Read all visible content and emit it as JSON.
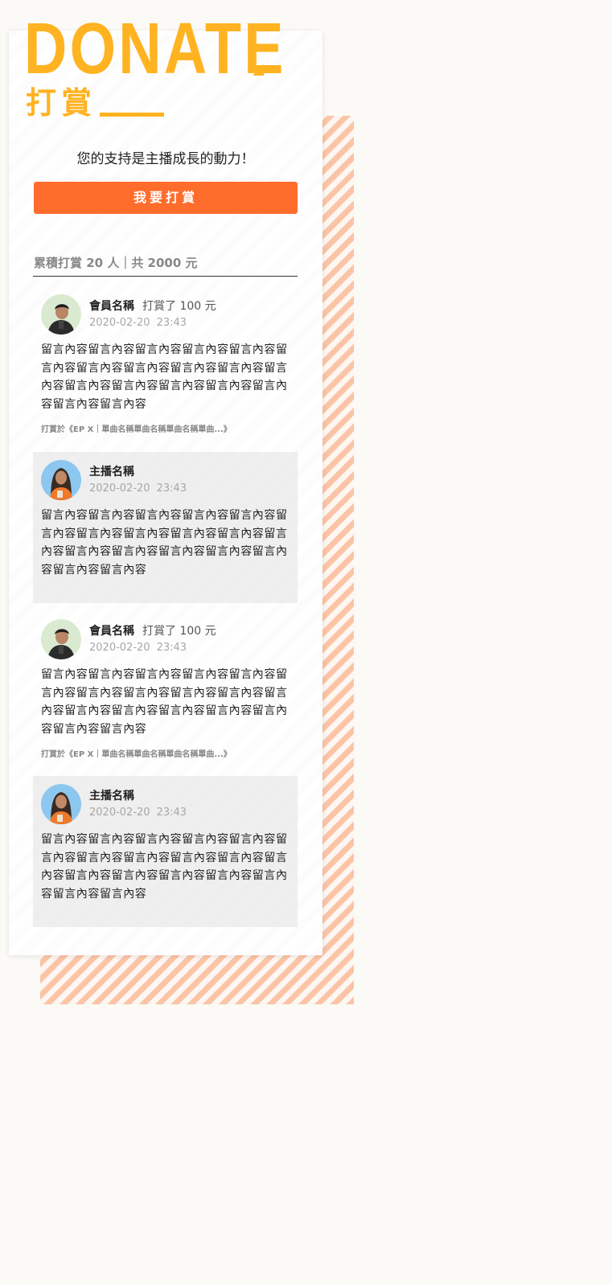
{
  "header": {
    "title_en": "DONATE",
    "title_zh": "打賞"
  },
  "support_text": "您的支持是主播成長的動力！",
  "donate_button_label": "我要打賞",
  "summary": "累積打賞 20 人｜共 2000 元",
  "entries": [
    {
      "type": "member",
      "name": "會員名稱",
      "amount": "打賞了 100 元",
      "date": "2020-02-20",
      "time": "23:43",
      "content": "留言內容留言內容留言內容留言內容留言內容留言內容留言內容留言內容留言內容留言內容留言內容留言內容留言內容留言內容留言內容留言內容留言內容留言內容",
      "source": "打賞於《EP X｜單曲名稱單曲名稱單曲名稱單曲...》"
    },
    {
      "type": "host",
      "name": "主播名稱",
      "date": "2020-02-20",
      "time": "23:43",
      "content": "留言內容留言內容留言內容留言內容留言內容留言內容留言內容留言內容留言內容留言內容留言內容留言內容留言內容留言內容留言內容留言內容留言內容留言內容"
    },
    {
      "type": "member",
      "name": "會員名稱",
      "amount": "打賞了 100 元",
      "date": "2020-02-20",
      "time": "23:43",
      "content": "留言內容留言內容留言內容留言內容留言內容留言內容留言內容留言內容留言內容留言內容留言內容留言內容留言內容留言內容留言內容留言內容留言內容留言內容",
      "source": "打賞於《EP X｜單曲名稱單曲名稱單曲名稱單曲...》"
    },
    {
      "type": "host",
      "name": "主播名稱",
      "date": "2020-02-20",
      "time": "23:43",
      "content": "留言內容留言內容留言內容留言內容留言內容留言內容留言內容留言內容留言內容留言內容留言內容留言內容留言內容留言內容留言內容留言內容留言內容留言內容"
    }
  ],
  "colors": {
    "accent_yellow": "#ffb321",
    "button_orange": "#ff6d2d",
    "stripe_peach": "#fbc4a6"
  }
}
